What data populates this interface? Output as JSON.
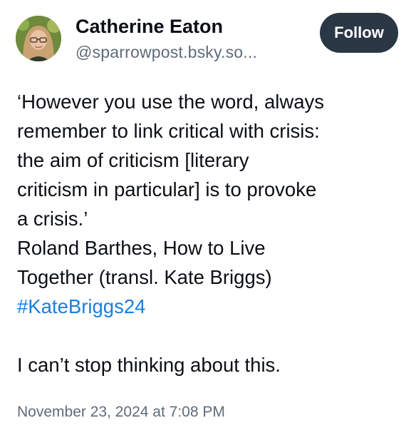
{
  "author": {
    "name": "Catherine Eaton",
    "handle": "@sparrowpost.bsky.so...",
    "avatar_icon": "avatar-photo"
  },
  "actions": {
    "follow_label": "Follow"
  },
  "post": {
    "lines": [
      "‘However you use the word, always",
      "remember to link critical with crisis:",
      "the aim of criticism [literary",
      "criticism in particular] is to provoke",
      "a crisis.’",
      "Roland Barthes, How to Live",
      "Together (transl. Kate Briggs)"
    ],
    "hashtag": "#KateBriggs24",
    "closing": "I can’t stop thinking about this."
  },
  "meta": {
    "timestamp": "November 23, 2024 at 7:08 PM"
  },
  "colors": {
    "follow_bg": "#2a3744",
    "hashtag": "#1a7fe0",
    "secondary_text": "#5f6b7a"
  }
}
